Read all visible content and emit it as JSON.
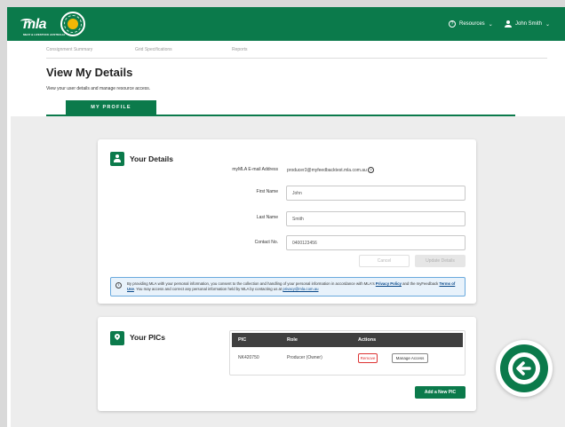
{
  "header": {
    "brand_text": "mla",
    "brand_subtext": "MEAT & LIVESTOCK AUSTRALIA",
    "resources_label": "Resources",
    "user_name": "John Smith"
  },
  "subnav": {
    "items": [
      "Consignment Summary",
      "Grid Specifications",
      "Reports"
    ]
  },
  "page": {
    "title": "View My Details",
    "description": "View your user details and manage resource access.",
    "tab_label": "MY PROFILE"
  },
  "details": {
    "title": "Your Details",
    "email_label": "myMLA E-mail Address",
    "email_value": "producer3@myfeedbacktest.mla.com.au",
    "first_name_label": "First Name",
    "first_name_value": "John",
    "last_name_label": "Last Name",
    "last_name_value": "Smith",
    "contact_label": "Contact No.",
    "contact_value": "0400123456",
    "cancel_label": "Cancel",
    "update_label": "Update Details",
    "notice_part1": "By providing MLA with your personal information, you consent to the collection and handling of your personal information in accordance with MLA's ",
    "privacy_link": "Privacy Policy",
    "notice_part2": " and the myFeedback ",
    "terms_link": "Terms of Use",
    "notice_part3": ". You may access and correct any personal information held by MLA by contacting us at ",
    "privacy_email": "privacy@mla.com.au"
  },
  "pics": {
    "title": "Your PICs",
    "columns": [
      "PIC",
      "Role",
      "Actions"
    ],
    "rows": [
      {
        "pic": "NK420750",
        "role": "Producer (Owner)",
        "remove_label": "Remove",
        "manage_label": "Manage Access"
      }
    ],
    "add_label": "Add a New PIC"
  }
}
